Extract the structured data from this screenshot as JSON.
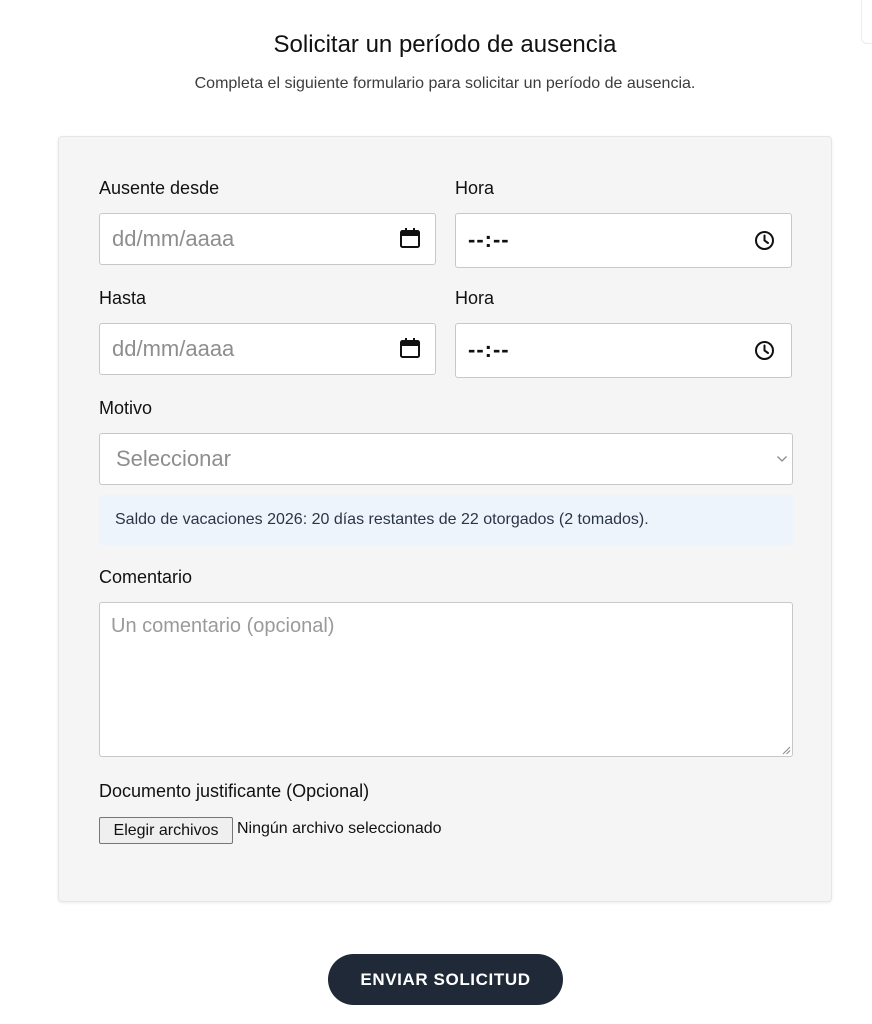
{
  "header": {
    "title": "Solicitar un período de ausencia",
    "subtitle": "Completa el siguiente formulario para solicitar un período de ausencia."
  },
  "form": {
    "from_date": {
      "label": "Ausente desde",
      "value": "dd/mm/aaaa",
      "icon": "calendar-icon"
    },
    "from_time": {
      "label": "Hora",
      "value": "--:--",
      "icon": "clock-icon"
    },
    "to_date": {
      "label": "Hasta",
      "value": "dd/mm/aaaa",
      "icon": "calendar-icon"
    },
    "to_time": {
      "label": "Hora",
      "value": "--:--",
      "icon": "clock-icon"
    },
    "reason": {
      "label": "Motivo",
      "placeholder": "Seleccionar",
      "icon": "chevron-down-icon"
    },
    "balance_info": "Saldo de vacaciones 2026: 20 días restantes de 22 otorgados (2 tomados).",
    "comment": {
      "label": "Comentario",
      "placeholder": "Un comentario (opcional)"
    },
    "document": {
      "label": "Documento justificante (Opcional)",
      "button_label": "Elegir archivos",
      "status": "Ningún archivo seleccionado"
    }
  },
  "submit_label": "ENVIAR SOLICITUD",
  "colors": {
    "card_background": "#f5f5f5",
    "info_background": "#edf4fc",
    "submit_background": "#1f2937",
    "submit_text": "#ffffff"
  }
}
